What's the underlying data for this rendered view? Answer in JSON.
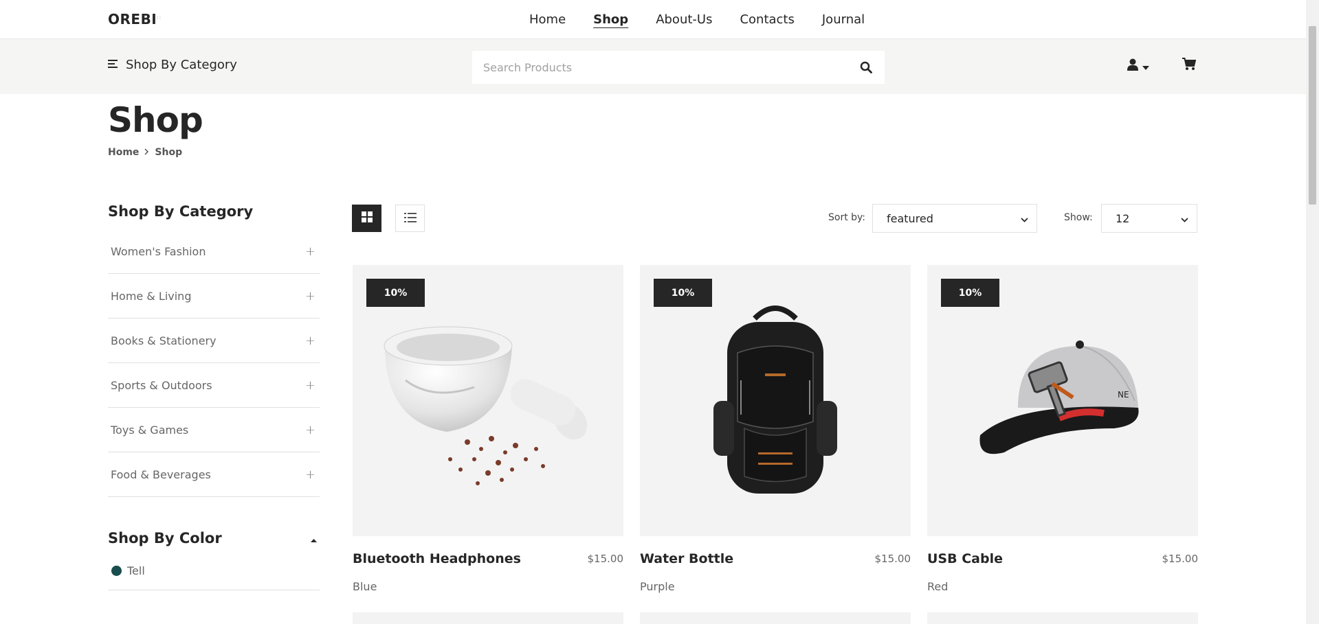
{
  "header": {
    "logo": "OREBI",
    "nav": [
      "Home",
      "Shop",
      "About-Us",
      "Contacts",
      "Journal"
    ],
    "active_nav": "Shop"
  },
  "catbar": {
    "category_button": "Shop By Category",
    "search_placeholder": "Search Products",
    "icons": [
      "menu-icon",
      "search-icon",
      "user-icon",
      "caret-down-icon",
      "cart-icon"
    ]
  },
  "page": {
    "title": "Shop",
    "breadcrumb": [
      "Home",
      "Shop"
    ]
  },
  "sidebar": {
    "category_heading": "Shop By Category",
    "categories": [
      "Women's Fashion",
      "Home & Living",
      "Books & Stationery",
      "Sports & Outdoors",
      "Toys & Games",
      "Food & Beverages"
    ],
    "color_heading": "Shop By Color",
    "colors": [
      {
        "label": "Tell",
        "hex": "#1a4d4d"
      }
    ]
  },
  "toolbar": {
    "sort_label": "Sort by:",
    "sort_value": "featured",
    "show_label": "Show:",
    "show_value": "12"
  },
  "products": [
    {
      "badge": "10%",
      "name": "Bluetooth Headphones",
      "price": "$15.00",
      "color": "Blue",
      "image": "mortar-and-pestle"
    },
    {
      "badge": "10%",
      "name": "Water Bottle",
      "price": "$15.00",
      "color": "Purple",
      "image": "black-backpack"
    },
    {
      "badge": "10%",
      "name": "USB Cable",
      "price": "$15.00",
      "color": "Red",
      "image": "snapback-cap"
    }
  ],
  "colors": {
    "dark": "#262626",
    "panel": "#f5f5f3",
    "card_bg": "#f3f3f3"
  }
}
